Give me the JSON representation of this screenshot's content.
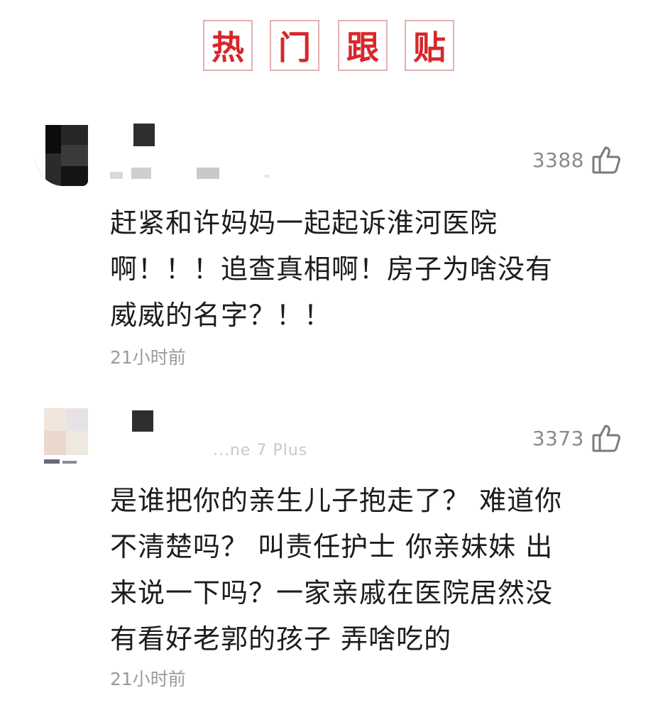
{
  "header": {
    "chars": [
      "热",
      "门",
      "跟",
      "贴"
    ],
    "accent_color": "#d8262b",
    "border_color": "#e2b0b0"
  },
  "comments": [
    {
      "likes": "3388",
      "like_icon": "thumbs-up-icon",
      "text_lines": [
        "赶紧和许妈妈一起起诉淮河医院",
        "啊！！！追查真相啊！房子为啥没有",
        "威威的名字？！！"
      ],
      "time": "21小时前"
    },
    {
      "likes": "3373",
      "like_icon": "thumbs-up-icon",
      "device_fragment": "...ne 7 Plus",
      "text_lines": [
        "是谁把你的亲生儿子抱走了？ 难道你",
        "不清楚吗？ 叫责任护士 你亲妹妹 出",
        "来说一下吗？一家亲戚在医院居然没",
        "有看好老郭的孩子 弄啥吃的"
      ],
      "time": "21小时前"
    }
  ]
}
